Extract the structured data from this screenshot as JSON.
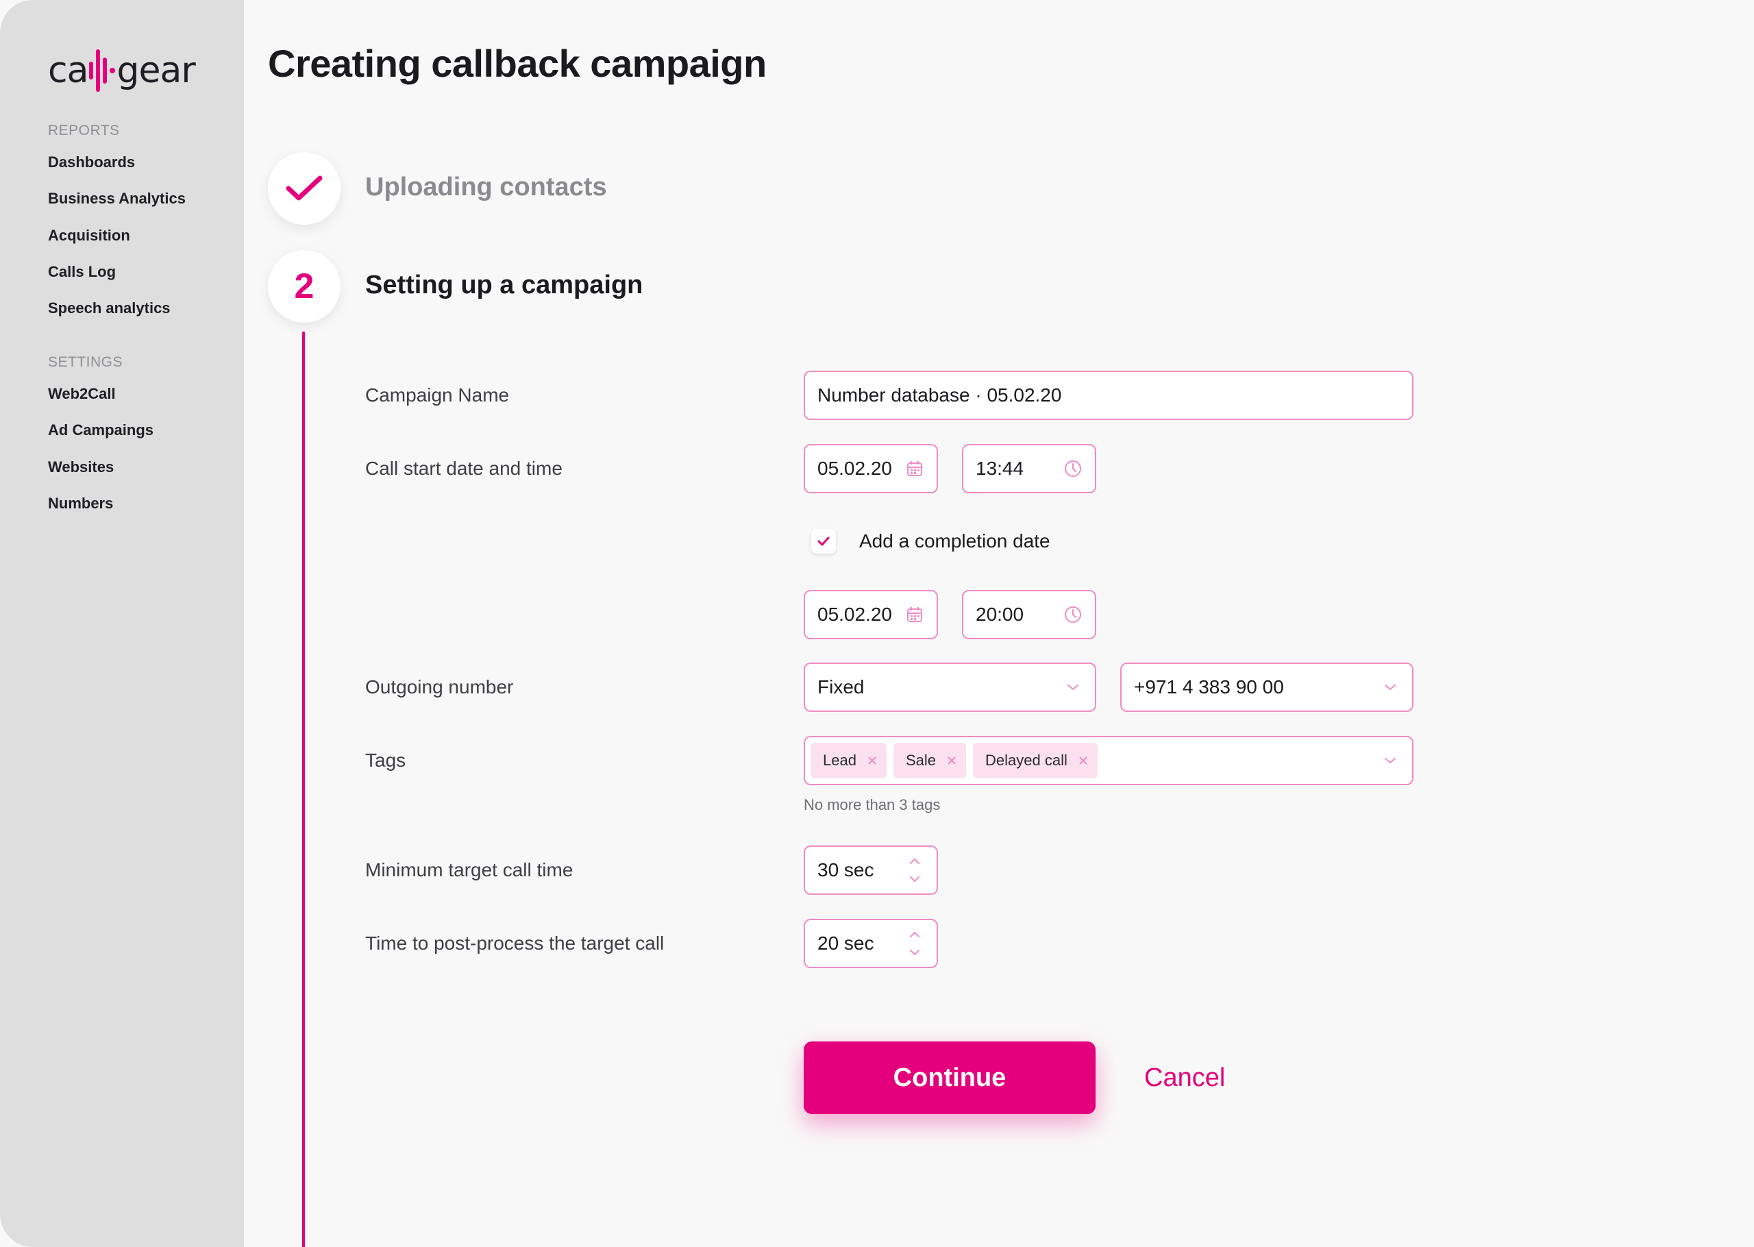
{
  "brand": {
    "logo_text_left": "ca",
    "logo_text_right": "gear",
    "accent": "#e4007c"
  },
  "sidebar": {
    "reports_heading": "REPORTS",
    "reports": [
      "Dashboards",
      "Business Analytics",
      "Acquisition",
      "Calls Log",
      "Speech analytics"
    ],
    "settings_heading": "SETTINGS",
    "settings": [
      "Web2Call",
      "Ad Campaings",
      "Websites",
      "Numbers"
    ]
  },
  "page": {
    "title": "Creating callback campaign"
  },
  "steps": [
    {
      "label": "Uploading contacts",
      "status": "done",
      "icon": "check-icon"
    },
    {
      "number": "2",
      "label": "Setting up a campaign",
      "status": "active"
    }
  ],
  "form": {
    "campaign_name": {
      "label": "Campaign Name",
      "value": "Number database · 05.02.20"
    },
    "start": {
      "label": "Call start date and time",
      "date": "05.02.20",
      "time": "13:44"
    },
    "completion": {
      "checkbox_label": "Add a completion date",
      "checked": true,
      "date": "05.02.20",
      "time": "20:00"
    },
    "outgoing": {
      "label": "Outgoing number",
      "type": "Fixed",
      "number": "+971 4 383 90 00"
    },
    "tags": {
      "label": "Tags",
      "items": [
        "Lead",
        "Sale",
        "Delayed call"
      ],
      "hint": "No more than 3 tags"
    },
    "min_call_time": {
      "label": "Minimum target call time",
      "value": "30 sec"
    },
    "post_process": {
      "label": "Time to post-process the target call",
      "value": "20 sec"
    }
  },
  "actions": {
    "continue": "Continue",
    "cancel": "Cancel"
  }
}
